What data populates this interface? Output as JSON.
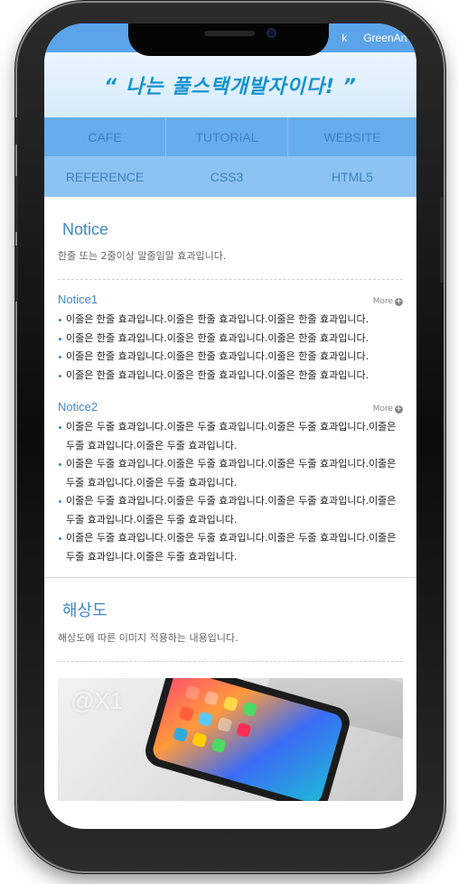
{
  "topbar": {
    "links": [
      "k",
      "GreenArt"
    ]
  },
  "header": {
    "slogan": "“ 나는 풀스택개발자이다! ”"
  },
  "nav": [
    "CAFE",
    "TUTORIAL",
    "WEBSITE",
    "REFERENCE",
    "CSS3",
    "HTML5"
  ],
  "notice_section": {
    "title": "Notice",
    "desc": "한줄 또는 2줄이상 말줄임말 효과입니다.",
    "notice1": {
      "title": "Notice1",
      "more": "More",
      "items": [
        "이줄은 한줄 효과입니다.이줄은 한줄 효과입니다.이줄은 한줄 효과입니다.",
        "이줄은 한줄 효과입니다.이줄은 한줄 효과입니다.이줄은 한줄 효과입니다.",
        "이줄은 한줄 효과입니다.이줄은 한줄 효과입니다.이줄은 한줄 효과입니다.",
        "이줄은 한줄 효과입니다.이줄은 한줄 효과입니다.이줄은 한줄 효과입니다."
      ]
    },
    "notice2": {
      "title": "Notice2",
      "more": "More",
      "items": [
        "이줄은 두줄 효과입니다.이줄은 두줄 효과입니다.이줄은 두줄 효과입니다.이줄은 두줄 효과입니다.이줄은 두줄 효과입니다.",
        "이줄은 두줄 효과입니다.이줄은 두줄 효과입니다.이줄은 두줄 효과입니다.이줄은 두줄 효과입니다.이줄은 두줄 효과입니다.",
        "이줄은 두줄 효과입니다.이줄은 두줄 효과입니다.이줄은 두줄 효과입니다.이줄은 두줄 효과입니다.이줄은 두줄 효과입니다.",
        "이줄은 두줄 효과입니다.이줄은 두줄 효과입니다.이줄은 두줄 효과입니다.이줄은 두줄 효과입니다.이줄은 두줄 효과입니다."
      ]
    }
  },
  "resolution_section": {
    "title": "해상도",
    "desc": "해상도에 따른 이미지 적용하는 내용입니다.",
    "image_label": "@X1"
  },
  "colors": {
    "accent": "#3f87c8",
    "nav_bg": "#66adec",
    "topbar_bg": "#5ca4ea"
  }
}
